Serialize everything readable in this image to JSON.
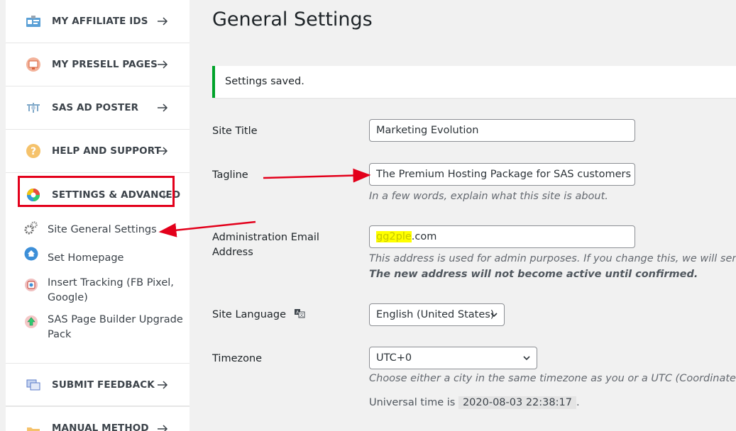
{
  "sidebar": {
    "items": [
      {
        "label": "MY AFFILIATE IDS",
        "icon": "id-card-icon"
      },
      {
        "label": "MY PRESELL PAGES",
        "icon": "presell-icon"
      },
      {
        "label": "SAS AD POSTER",
        "icon": "ad-poster-icon"
      },
      {
        "label": "HELP AND SUPPORT",
        "icon": "help-icon"
      },
      {
        "label": "SETTINGS & ADVANCED",
        "icon": "settings-palette-icon"
      },
      {
        "label": "SUBMIT FEEDBACK",
        "icon": "feedback-icon"
      },
      {
        "label": "MANUAL METHOD",
        "icon": "folder-icon"
      }
    ],
    "sub_items": [
      {
        "label": "Site General Settings",
        "icon": "gears-icon"
      },
      {
        "label": "Set Homepage",
        "icon": "home-icon"
      },
      {
        "label": "Insert Tracking (FB Pixel, Google)",
        "icon": "tracking-icon"
      },
      {
        "label": "SAS Page Builder Upgrade Pack",
        "icon": "upgrade-icon"
      }
    ]
  },
  "main": {
    "title": "General Settings",
    "notice": "Settings saved.",
    "fields": {
      "site_title": {
        "label": "Site Title",
        "value": "Marketing Evolution"
      },
      "tagline": {
        "label": "Tagline",
        "value": "The Premium Hosting Package for SAS customers",
        "description": "In a few words, explain what this site is about."
      },
      "admin_email": {
        "label": "Administration Email Address",
        "value_suffix": ".com",
        "description": "This address is used for admin purposes. If you change this, we will send yo",
        "description_bold": "The new address will not become active until confirmed."
      },
      "site_language": {
        "label": "Site Language",
        "value": "English (United States)"
      },
      "timezone": {
        "label": "Timezone",
        "value": "UTC+0",
        "description": "Choose either a city in the same timezone as you or a UTC (Coordinated Un"
      },
      "universal_time": {
        "prefix": "Universal time is",
        "value": "2020-08-03 22:38:17",
        "suffix": "."
      }
    }
  },
  "colors": {
    "accent_red": "#e3001b",
    "notice_green": "#00a32a",
    "highlight": "#ffff00"
  }
}
